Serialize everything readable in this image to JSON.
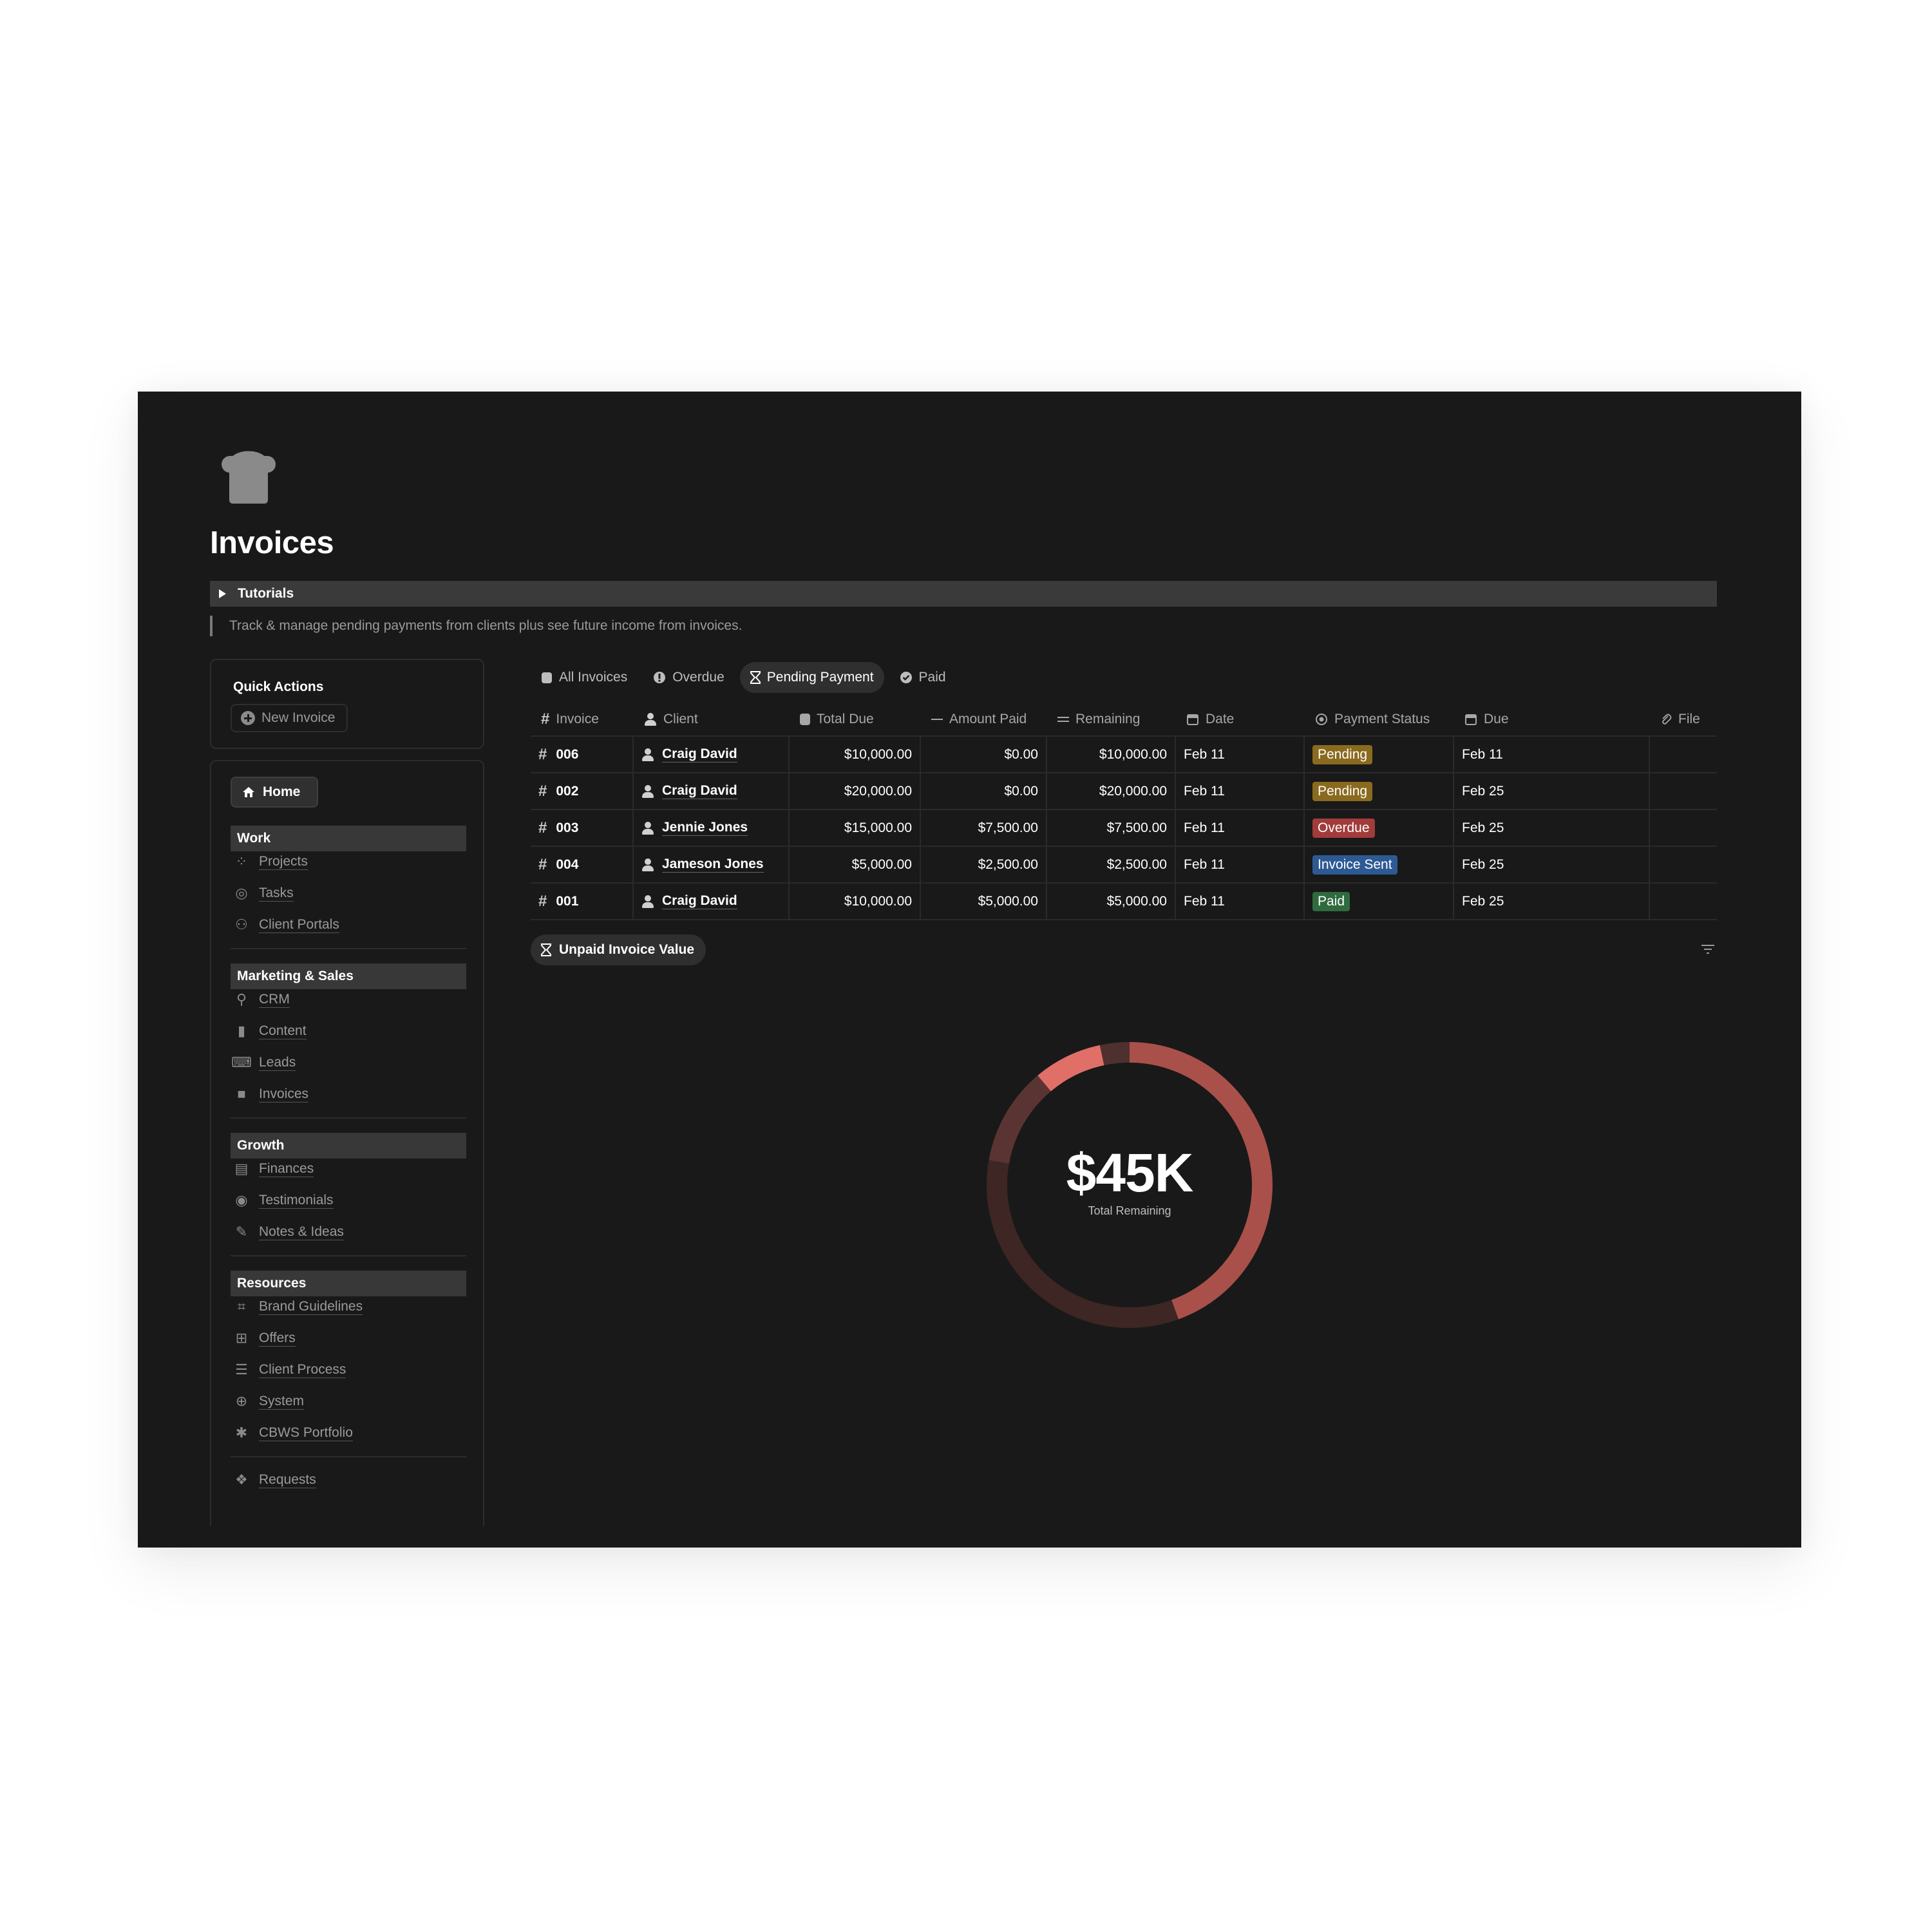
{
  "page": {
    "title": "Invoices",
    "toggle_label": "Tutorials",
    "description": "Track & manage pending payments from clients plus see future income from invoices."
  },
  "quick_actions": {
    "title": "Quick Actions",
    "new_invoice": "New Invoice"
  },
  "nav": {
    "home": "Home",
    "sections": [
      {
        "title": "Work",
        "items": [
          "Projects",
          "Tasks",
          "Client Portals"
        ]
      },
      {
        "title": "Marketing & Sales",
        "items": [
          "CRM",
          "Content",
          "Leads",
          "Invoices"
        ]
      },
      {
        "title": "Growth",
        "items": [
          "Finances",
          "Testimonials",
          "Notes & Ideas"
        ]
      },
      {
        "title": "Resources",
        "items": [
          "Brand Guidelines",
          "Offers",
          "Client Process",
          "System",
          "CBWS Portfolio"
        ]
      }
    ],
    "footer_item": "Requests"
  },
  "tabs": [
    "All Invoices",
    "Overdue",
    "Pending Payment",
    "Paid"
  ],
  "active_tab": "Pending Payment",
  "table": {
    "columns": [
      "Invoice",
      "Client",
      "Total Due",
      "Amount Paid",
      "Remaining",
      "Date",
      "Payment Status",
      "Due",
      "File"
    ],
    "rows": [
      {
        "invoice": "006",
        "client": "Craig David",
        "total_due": "$10,000.00",
        "amount_paid": "$0.00",
        "remaining": "$10,000.00",
        "date": "Feb 11",
        "status": "Pending",
        "due": "Feb 11",
        "file": ""
      },
      {
        "invoice": "002",
        "client": "Craig David",
        "total_due": "$20,000.00",
        "amount_paid": "$0.00",
        "remaining": "$20,000.00",
        "date": "Feb 11",
        "status": "Pending",
        "due": "Feb 25",
        "file": ""
      },
      {
        "invoice": "003",
        "client": "Jennie Jones",
        "total_due": "$15,000.00",
        "amount_paid": "$7,500.00",
        "remaining": "$7,500.00",
        "date": "Feb 11",
        "status": "Overdue",
        "due": "Feb 25",
        "file": ""
      },
      {
        "invoice": "004",
        "client": "Jameson Jones",
        "total_due": "$5,000.00",
        "amount_paid": "$2,500.00",
        "remaining": "$2,500.00",
        "date": "Feb 11",
        "status": "Invoice Sent",
        "due": "Feb 25",
        "file": ""
      },
      {
        "invoice": "001",
        "client": "Craig David",
        "total_due": "$10,000.00",
        "amount_paid": "$5,000.00",
        "remaining": "$5,000.00",
        "date": "Feb 11",
        "status": "Paid",
        "due": "Feb 25",
        "file": ""
      }
    ]
  },
  "status_colors": {
    "Pending": "#8a6a1e",
    "Overdue": "#a23b3b",
    "Invoice Sent": "#2e5a93",
    "Paid": "#2f6b3f"
  },
  "chart_section": {
    "chip_label": "Unpaid Invoice Value",
    "total_value": "$45K",
    "total_label": "Total Remaining"
  },
  "chart_data": {
    "type": "pie",
    "variant": "donut",
    "slices": [
      {
        "value": 20000,
        "color": "#a9504a"
      },
      {
        "value": 15000,
        "color": "#3d2624"
      },
      {
        "value": 5000,
        "color": "#5a3432"
      },
      {
        "value": 3500,
        "color": "#e06f68"
      },
      {
        "value": 1500,
        "color": "#4e302e"
      }
    ],
    "center_value": "$45K",
    "center_label": "Total Remaining"
  }
}
